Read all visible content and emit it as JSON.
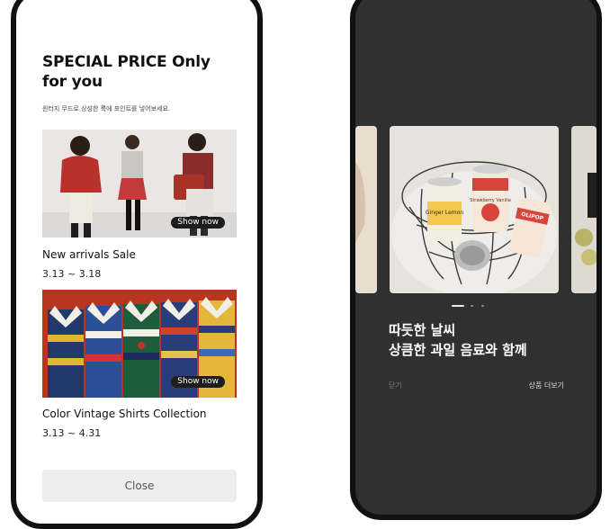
{
  "promo": {
    "title": "SPECIAL PRICE Only for you",
    "subtitle": "윈터지 무드로 상성한 룩에 포인트를 넣어보세요.",
    "cards": [
      {
        "shop_label": "Show now",
        "title": "New arrivals Sale",
        "date": "3.13 ~ 3.18"
      },
      {
        "shop_label": "Show now",
        "title": "Color Vintage Shirts Collection",
        "date": "3.13 ~ 4.31"
      }
    ],
    "close_label": "Close"
  },
  "story": {
    "headline_line1": "따듯한 날씨",
    "headline_line2": "상큼한 과일 음료와 함께",
    "dismiss_label": "닫기",
    "more_label": "상품 더보기",
    "can_labels": [
      "Ginger Lemon",
      "Strawberry Vanilla",
      "OLIPOP"
    ],
    "slides_total": 3,
    "active_slide": 1
  },
  "colors": {
    "dark_background": "#303030",
    "shop_badge": "#1d1d1d",
    "close_button": "#ededed"
  }
}
